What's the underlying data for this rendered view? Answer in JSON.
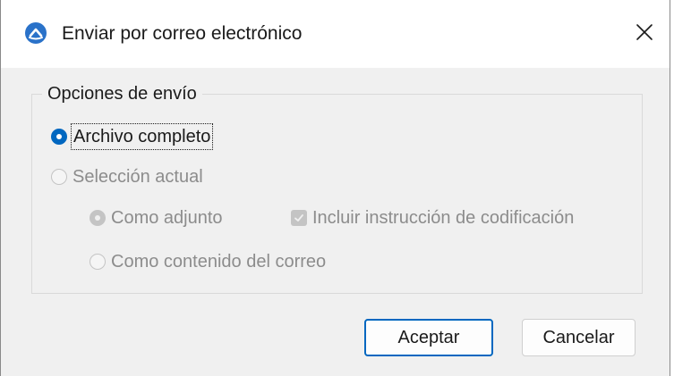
{
  "window": {
    "title": "Enviar por correo electrónico",
    "app_icon": "app-logo-icon",
    "close_icon": "close-icon"
  },
  "send_options": {
    "legend": "Opciones de envío",
    "options": [
      {
        "label": "Archivo completo",
        "selected": true,
        "enabled": true
      },
      {
        "label": "Selección actual",
        "selected": false,
        "enabled": false
      }
    ],
    "sub_options": [
      {
        "label": "Como adjunto",
        "selected": true,
        "enabled": false
      },
      {
        "label": "Como contenido del correo",
        "selected": false,
        "enabled": false
      }
    ],
    "include_encoding": {
      "label": "Incluir instrucción de codificación",
      "checked": true,
      "enabled": false
    }
  },
  "buttons": {
    "accept": "Aceptar",
    "cancel": "Cancelar"
  },
  "colors": {
    "accent": "#0067c0",
    "dialog_bg": "#f0f0f0",
    "disabled_text": "#8c8c8c"
  }
}
